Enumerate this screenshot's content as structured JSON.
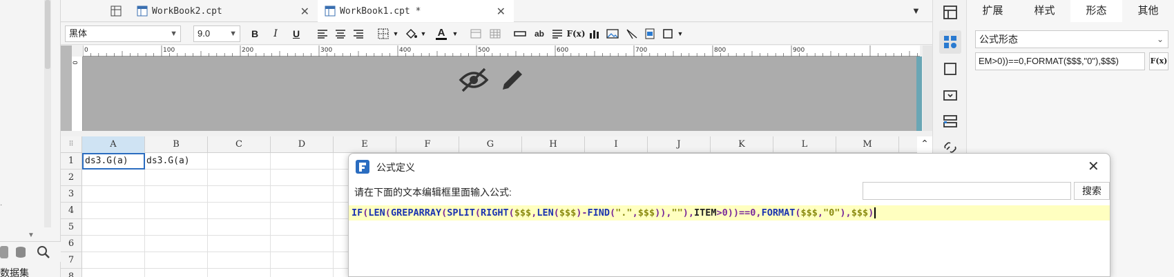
{
  "tabs": [
    {
      "label": "WorkBook2.cpt",
      "active": false
    },
    {
      "label": "WorkBook1.cpt *",
      "active": true
    }
  ],
  "toolbar": {
    "font_family": "黑体",
    "font_size": "9.0",
    "bold": "B",
    "italic": "I",
    "underline": "U",
    "text_label": "ab",
    "formula_label": "F(x)"
  },
  "ruler": {
    "ticks": [
      "0",
      "100",
      "200",
      "300",
      "400",
      "500",
      "600",
      "700",
      "800",
      "900"
    ],
    "v_tick": "0"
  },
  "grid": {
    "columns": [
      "A",
      "B",
      "C",
      "D",
      "E",
      "F",
      "G",
      "H",
      "I",
      "J",
      "K",
      "L",
      "M"
    ],
    "rows": [
      "1",
      "2",
      "3",
      "4",
      "5",
      "6",
      "7",
      "8"
    ],
    "cells": {
      "A1": "ds3.G(a)",
      "B1": "ds3.G(a)"
    }
  },
  "left_panel": {
    "dataset_label": "数据集"
  },
  "right_panel": {
    "tabs": [
      {
        "label": "扩展",
        "active": false
      },
      {
        "label": "样式",
        "active": false
      },
      {
        "label": "形态",
        "active": true
      },
      {
        "label": "其他",
        "active": false
      }
    ],
    "shape_select": "公式形态",
    "formula_field": "EM>0))==0,FORMAT($$$,\"0\"),$$$)",
    "formula_button": "F(x)"
  },
  "dialog": {
    "title": "公式定义",
    "prompt": "请在下面的文本编辑框里面输入公式:",
    "search_value": "",
    "search_button": "搜索",
    "formula_tokens": [
      {
        "t": "IF",
        "c": "kw"
      },
      {
        "t": "(",
        "c": "op"
      },
      {
        "t": "LEN",
        "c": "kw"
      },
      {
        "t": "(",
        "c": "op"
      },
      {
        "t": "GREPARRAY",
        "c": "kw"
      },
      {
        "t": "(",
        "c": "op"
      },
      {
        "t": "SPLIT",
        "c": "kw"
      },
      {
        "t": "(",
        "c": "op"
      },
      {
        "t": "RIGHT",
        "c": "kw"
      },
      {
        "t": "(",
        "c": "op"
      },
      {
        "t": "$$$",
        "c": "str"
      },
      {
        "t": ",",
        "c": "op"
      },
      {
        "t": "LEN",
        "c": "kw"
      },
      {
        "t": "(",
        "c": "op"
      },
      {
        "t": "$$$",
        "c": "str"
      },
      {
        "t": ")-",
        "c": "op"
      },
      {
        "t": "FIND",
        "c": "kw"
      },
      {
        "t": "(",
        "c": "op"
      },
      {
        "t": "\".\"",
        "c": "str"
      },
      {
        "t": ",",
        "c": "op"
      },
      {
        "t": "$$$",
        "c": "str"
      },
      {
        "t": ")),",
        "c": "op"
      },
      {
        "t": "\"\"",
        "c": "str"
      },
      {
        "t": "),",
        "c": "op"
      },
      {
        "t": "ITEM",
        "c": "tx"
      },
      {
        "t": ">0",
        "c": "op"
      },
      {
        "t": "))==0,",
        "c": "op"
      },
      {
        "t": "FORMAT",
        "c": "kw"
      },
      {
        "t": "(",
        "c": "op"
      },
      {
        "t": "$$$",
        "c": "str"
      },
      {
        "t": ",",
        "c": "op"
      },
      {
        "t": "\"0\"",
        "c": "str"
      },
      {
        "t": "),",
        "c": "op"
      },
      {
        "t": "$$$",
        "c": "str"
      },
      {
        "t": ")",
        "c": "op"
      }
    ]
  }
}
